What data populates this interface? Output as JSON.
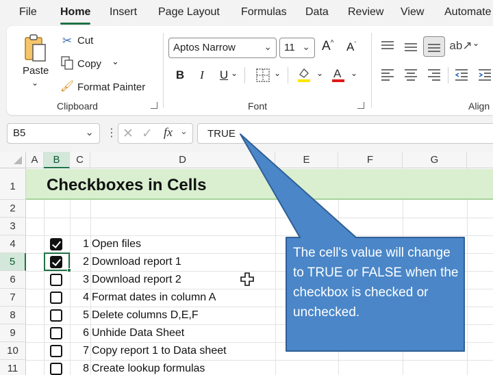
{
  "menu": {
    "tabs": [
      {
        "label": "File"
      },
      {
        "label": "Home"
      },
      {
        "label": "Insert"
      },
      {
        "label": "Page Layout"
      },
      {
        "label": "Formulas"
      },
      {
        "label": "Data"
      },
      {
        "label": "Review"
      },
      {
        "label": "View"
      },
      {
        "label": "Automate"
      }
    ],
    "active_tab": "Home"
  },
  "ribbon": {
    "clipboard": {
      "paste_label": "Paste",
      "cut_label": "Cut",
      "copy_label": "Copy",
      "format_painter_label": "Format Painter",
      "group_label": "Clipboard"
    },
    "font": {
      "font_name": "Aptos Narrow",
      "font_size": "11",
      "group_label": "Font",
      "bold": "B",
      "italic": "I",
      "underline": "U"
    },
    "alignment": {
      "group_label": "Align"
    }
  },
  "formula_bar": {
    "name_box": "B5",
    "fx_label": "fx",
    "value": "TRUE"
  },
  "grid": {
    "columns": [
      "A",
      "B",
      "C",
      "D",
      "E",
      "F",
      "G"
    ],
    "selected_column": "B",
    "rows": [
      "1",
      "2",
      "3",
      "4",
      "5",
      "6",
      "7",
      "8",
      "9",
      "10",
      "11"
    ],
    "selected_row": "5",
    "title": "Checkboxes in Cells",
    "tasks": [
      {
        "num": "1",
        "text": "Open files",
        "checked": true
      },
      {
        "num": "2",
        "text": "Download report 1",
        "checked": true
      },
      {
        "num": "3",
        "text": "Download report 2",
        "checked": false
      },
      {
        "num": "4",
        "text": "Format dates in column A",
        "checked": false
      },
      {
        "num": "5",
        "text": "Delete columns D,E,F",
        "checked": false
      },
      {
        "num": "6",
        "text": "Unhide Data Sheet",
        "checked": false
      },
      {
        "num": "7",
        "text": "Copy report 1 to Data sheet",
        "checked": false
      },
      {
        "num": "8",
        "text": "Create lookup formulas",
        "checked": false
      }
    ]
  },
  "callout": {
    "text": "The cell's value will change to TRUE or FALSE when the checkbox is checked or unchecked."
  },
  "colors": {
    "accent": "#1e7145",
    "title_band": "#d9efd0",
    "callout_fill": "#4a86c8",
    "callout_stroke": "#2f5f96"
  },
  "icons": {
    "cursor": "move-cross-icon",
    "paste": "clipboard-icon",
    "cut": "scissors-icon",
    "copy": "copy-icon",
    "format_painter": "paintbrush-icon"
  }
}
